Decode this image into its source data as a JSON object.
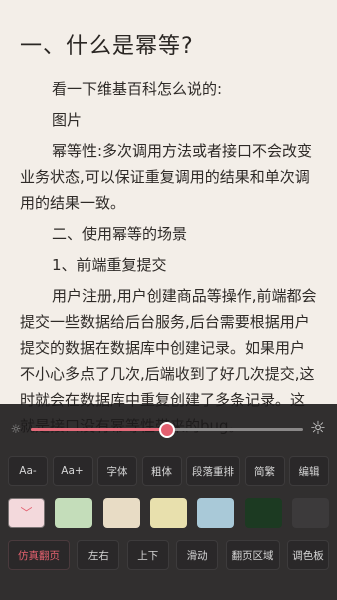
{
  "article": {
    "title": "一、什么是幂等?",
    "paragraphs": [
      "看一下维基百科怎么说的:",
      "图片",
      "幂等性:多次调用方法或者接口不会改变业务状态,可以保证重复调用的结果和单次调用的结果一致。",
      "二、使用幂等的场景",
      "1、前端重复提交",
      "用户注册,用户创建商品等操作,前端都会提交一些数据给后台服务,后台需要根据用户提交的数据在数据库中创建记录。如果用户不小心多点了几次,后端收到了好几次提交,这时就会在数据库中重复创建了多条记录。这就是接口没有幂等性带来的bug。"
    ]
  },
  "settings": {
    "brightness": {
      "value_percent": 50,
      "low_icon": "sun-small-icon",
      "high_icon": "sun-large-icon"
    },
    "font_row": {
      "decrease": "Aa-",
      "increase": "Aa+",
      "font": "字体",
      "bold": "粗体",
      "reformat": "段落重排",
      "traditional": "简繁",
      "edit": "编辑"
    },
    "swatches": {
      "colors": [
        "#f3d9dc",
        "#c4ddba",
        "#e8dcc5",
        "#e8e0ad",
        "#a9c9d8",
        "#1c3a22",
        "#3c3a3b"
      ]
    },
    "page_row": {
      "simulated": "仿真翻页",
      "horizontal": "左右",
      "vertical": "上下",
      "slide": "滑动",
      "page_area": "翻页区域",
      "palette": "调色板"
    },
    "accent_color": "#e35f6f"
  }
}
